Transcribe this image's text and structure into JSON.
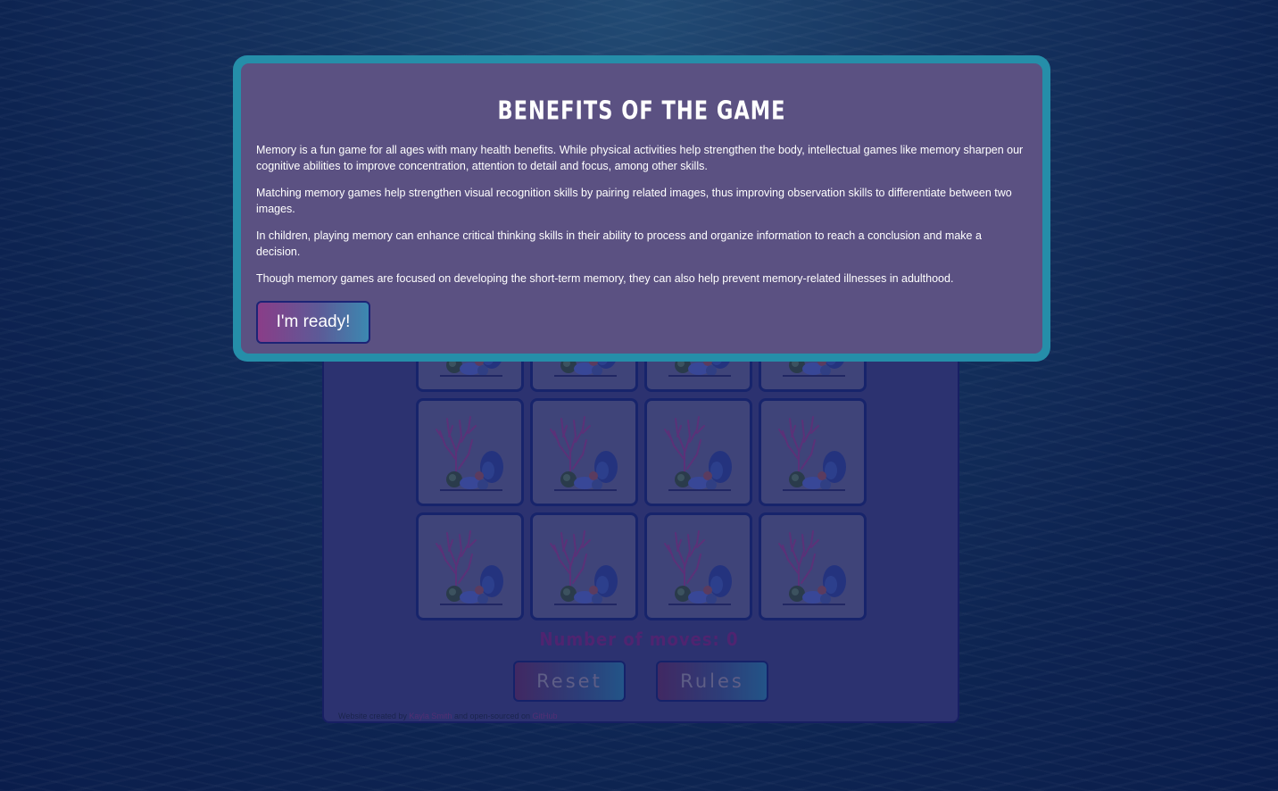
{
  "modal": {
    "title": "Benefits of the game",
    "paragraphs": [
      "Memory is a fun game for all ages with many health benefits. While physical activities help strengthen the body, intellectual games like memory sharpen our cognitive abilities to improve concentration, attention to detail and focus, among other skills.",
      "Matching memory games help strengthen visual recognition skills by pairing related images, thus improving observation skills to differentiate between two images.",
      "In children, playing memory can enhance critical thinking skills in their ability to process and organize information to reach a conclusion and make a decision.",
      "Though memory games are focused on developing the short-term memory, they can also help prevent memory-related illnesses in adulthood."
    ],
    "ready_label": "I'm ready!"
  },
  "game": {
    "moves_label": "Number of moves: 0",
    "reset_label": "Reset",
    "rules_label": "Rules",
    "card_icon": "coral-reef-icon"
  },
  "footer": {
    "prefix": "Website created by",
    "author": "Kayla Smith",
    "middle": "and open-sourced on",
    "platform": "GitHub"
  },
  "colors": {
    "modal_border": "#258ea9",
    "modal_bg": "#5b5182",
    "card_bg": "#54578e",
    "card_border": "#1d2a7a"
  }
}
